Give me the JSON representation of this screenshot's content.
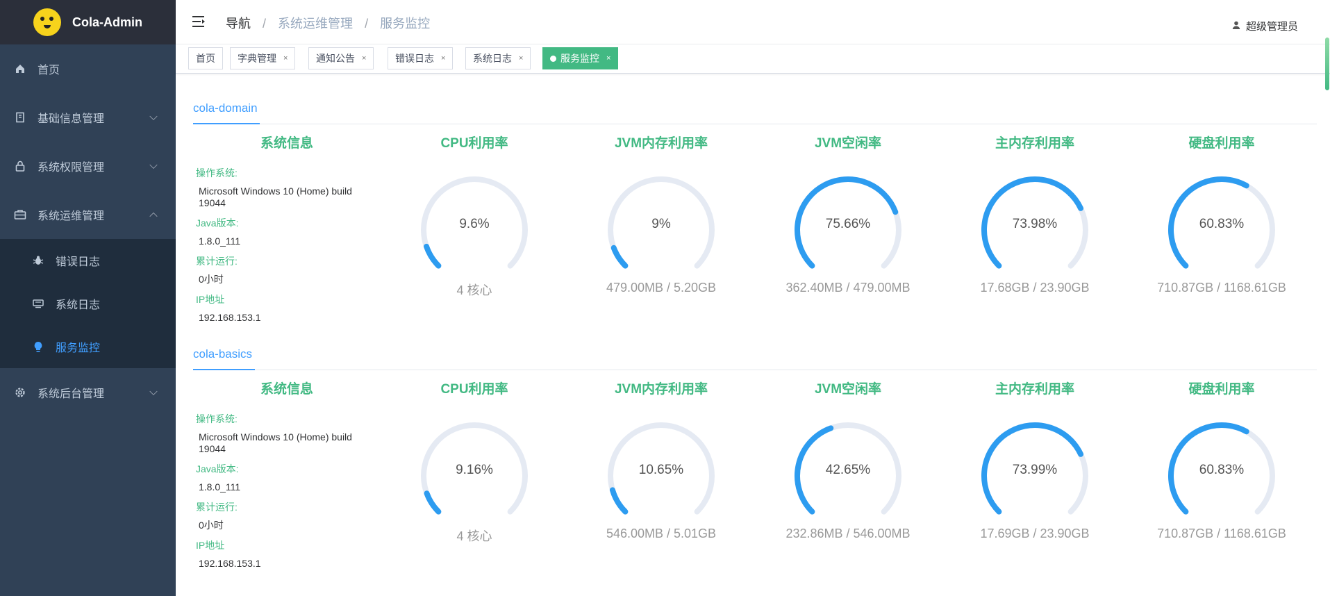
{
  "app": {
    "title": "Cola-Admin"
  },
  "colors": {
    "sidebar_bg": "#304156",
    "accent": "#409eff",
    "green": "#42b983",
    "gauge_track": "#e5eaf3",
    "gauge_fill": "#2d9cf0"
  },
  "sidebar": {
    "items": [
      {
        "label": "首页",
        "icon": "home-icon"
      },
      {
        "label": "基础信息管理",
        "icon": "building-icon"
      },
      {
        "label": "系统权限管理",
        "icon": "lock-icon"
      },
      {
        "label": "系统运维管理",
        "icon": "toolbox-icon"
      },
      {
        "label": "系统后台管理",
        "icon": "gear-icon"
      }
    ],
    "subitems": [
      {
        "label": "错误日志",
        "icon": "bug-icon"
      },
      {
        "label": "系统日志",
        "icon": "log-icon"
      },
      {
        "label": "服务监控",
        "icon": "bulb-icon"
      }
    ]
  },
  "header": {
    "breadcrumb": [
      "导航",
      "系统运维管理",
      "服务监控"
    ],
    "user": "超级管理员"
  },
  "tags": [
    {
      "label": "首页"
    },
    {
      "label": "字典管理",
      "close": "×"
    },
    {
      "label": "通知公告",
      "close": "×"
    },
    {
      "label": "错误日志",
      "close": "×"
    },
    {
      "label": "系统日志",
      "close": "×"
    },
    {
      "label": "服务监控",
      "close": "×"
    }
  ],
  "labels": {
    "sysinfo_title": "系统信息",
    "cpu": "CPU利用率",
    "jvm_mem": "JVM内存利用率",
    "jvm_idle": "JVM空闲率",
    "mem": "主内存利用率",
    "disk": "硬盘利用率",
    "os": "操作系统:",
    "java": "Java版本:",
    "uptime": "累计运行:",
    "ip": "IP地址"
  },
  "servers": [
    {
      "name": "cola-domain",
      "os": "Microsoft Windows 10 (Home) build 19044",
      "java": "1.8.0_111",
      "uptime": "0小时",
      "ip": "192.168.153.1",
      "gauges": [
        {
          "value": 9.6,
          "text": "9.6%",
          "sub": "4 核心"
        },
        {
          "value": 9,
          "text": "9%",
          "sub": "479.00MB / 5.20GB"
        },
        {
          "value": 75.66,
          "text": "75.66%",
          "sub": "362.40MB / 479.00MB"
        },
        {
          "value": 73.98,
          "text": "73.98%",
          "sub": "17.68GB / 23.90GB"
        },
        {
          "value": 60.83,
          "text": "60.83%",
          "sub": "710.87GB / 1168.61GB"
        }
      ]
    },
    {
      "name": "cola-basics",
      "os": "Microsoft Windows 10 (Home) build 19044",
      "java": "1.8.0_111",
      "uptime": "0小时",
      "ip": "192.168.153.1",
      "gauges": [
        {
          "value": 9.16,
          "text": "9.16%",
          "sub": "4 核心"
        },
        {
          "value": 10.65,
          "text": "10.65%",
          "sub": "546.00MB / 5.01GB"
        },
        {
          "value": 42.65,
          "text": "42.65%",
          "sub": "232.86MB / 546.00MB"
        },
        {
          "value": 73.99,
          "text": "73.99%",
          "sub": "17.69GB / 23.90GB"
        },
        {
          "value": 60.83,
          "text": "60.83%",
          "sub": "710.87GB / 1168.61GB"
        }
      ]
    }
  ]
}
